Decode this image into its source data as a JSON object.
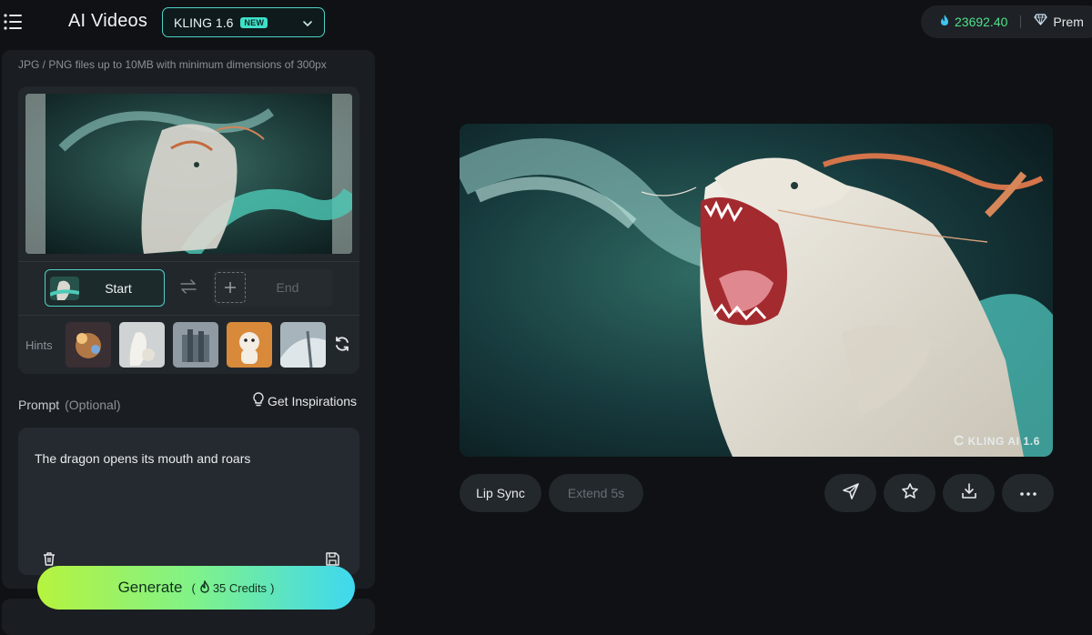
{
  "header": {
    "app_title": "AI Videos",
    "model_name": "KLING 1.6",
    "model_badge": "NEW",
    "credits_value": "23692.40",
    "plan_label": "Prem"
  },
  "upload": {
    "hint": "JPG / PNG files up to 10MB with minimum dimensions of 300px"
  },
  "frames": {
    "start_label": "Start",
    "end_label": "End"
  },
  "hints": {
    "label": "Hints"
  },
  "prompt": {
    "label": "Prompt",
    "optional": "(Optional)",
    "inspiration_label": "Get Inspirations",
    "text": "The dragon opens its mouth and roars"
  },
  "generate": {
    "label": "Generate",
    "credits_open": "(",
    "credits_text": "35 Credits",
    "credits_close": ")"
  },
  "video": {
    "watermark": "KLING AI 1.6"
  },
  "actions": {
    "lip_sync": "Lip Sync",
    "extend": "Extend 5s"
  },
  "colors": {
    "accent": "#4fd1c5",
    "credits": "#4ee08a",
    "background": "#0f1114"
  }
}
